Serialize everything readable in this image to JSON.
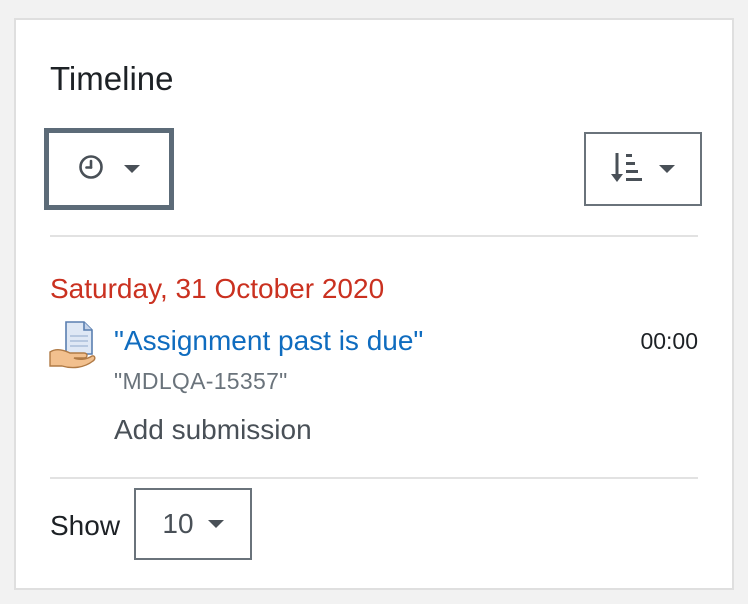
{
  "block": {
    "title": "Timeline"
  },
  "controls": {
    "filter_icon": "clock-icon",
    "sort_icon": "sort-amount-down-icon",
    "caret_icon": "caret-down-icon"
  },
  "events": {
    "date": "Saturday, 31 October 2020",
    "items": [
      {
        "icon": "assignment-icon",
        "name": "\"Assignment past is due\"",
        "course": "\"MDLQA-15357\"",
        "time": "00:00",
        "action": "Add submission"
      }
    ]
  },
  "footer": {
    "show_label": "Show",
    "show_value": "10"
  },
  "colors": {
    "date": "#ca3120",
    "link": "#0f6cbf",
    "focus_border": "#5c6b78"
  }
}
